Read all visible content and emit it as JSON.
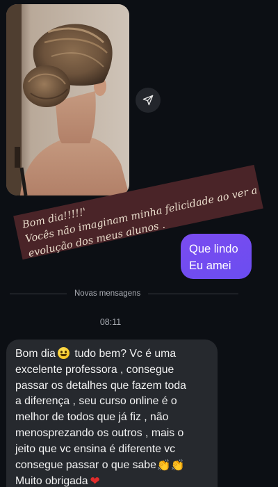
{
  "thread": {
    "received_image": {
      "alt_icon": "received-photo"
    },
    "share_icon": "share-arrow-icon",
    "overlay_caption": {
      "lines": [
        "Bom dia!!!!!'",
        "Vocês não imaginam minha felicidade ao ver a",
        "evolução dos meus alunos ."
      ]
    },
    "sent_message": {
      "lines": [
        "Que lindo",
        "Eu amei"
      ]
    },
    "new_messages_label": "Novas mensagens",
    "timestamp": "08:11",
    "received_message": {
      "line1_before": "Bom dia",
      "line1_after": " tudo bem? Vc é uma",
      "line2": "excelente professora , consegue",
      "line3": "passar os detalhes que fazem toda",
      "line4": "a diferença , seu curso online é o",
      "line5": "melhor de todos que já fiz , não",
      "line6": "menosprezando os outros , mais o",
      "line7": "jeito que vc ensina é diferente vc",
      "line8": "consegue passar o que sabe",
      "line9": "Muito obrigada",
      "emojis": {
        "smile": "smiley-emoji",
        "clap": "👏👏",
        "heart": "❤"
      }
    }
  },
  "colors": {
    "background": "#0c0f14",
    "sent_bubble": "#7a4cf0",
    "received_bubble": "#26292e",
    "banner": "#4a2428"
  }
}
